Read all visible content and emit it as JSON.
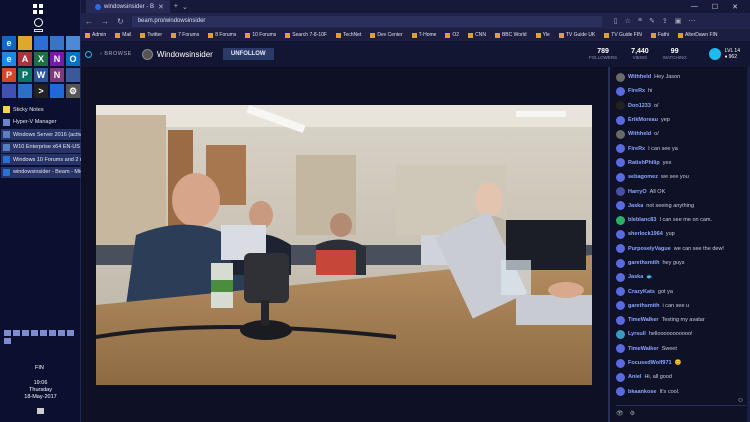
{
  "taskbar": {
    "tiles": [
      {
        "icon": "edge-icon",
        "color": "#1565c0",
        "glyph": "e"
      },
      {
        "icon": "explorer-icon",
        "color": "#e0a62e",
        "glyph": ""
      },
      {
        "icon": "store-icon",
        "color": "#2b6fd6",
        "glyph": ""
      },
      {
        "icon": "weather-icon",
        "color": "#3a74c8",
        "glyph": ""
      },
      {
        "icon": "photos-icon",
        "color": "#4a8ad8",
        "glyph": ""
      },
      {
        "icon": "ie-icon",
        "color": "#1e88e5",
        "glyph": "e"
      },
      {
        "icon": "access-icon",
        "color": "#a4373a",
        "glyph": "A"
      },
      {
        "icon": "excel-icon",
        "color": "#1d7044",
        "glyph": "X"
      },
      {
        "icon": "onenote-icon",
        "color": "#7719aa",
        "glyph": "N"
      },
      {
        "icon": "outlook-icon",
        "color": "#0072c6",
        "glyph": "O"
      },
      {
        "icon": "powerpoint-icon",
        "color": "#d24726",
        "glyph": "P"
      },
      {
        "icon": "publisher-icon",
        "color": "#077568",
        "glyph": "P"
      },
      {
        "icon": "word-icon",
        "color": "#2b579a",
        "glyph": "W"
      },
      {
        "icon": "onenote2-icon",
        "color": "#80397b",
        "glyph": "N"
      },
      {
        "icon": "groove-icon",
        "color": "#3b5998",
        "glyph": ""
      },
      {
        "icon": "people-icon",
        "color": "#3f51b5",
        "glyph": ""
      },
      {
        "icon": "calendar-icon",
        "color": "#2a6fc9",
        "glyph": ""
      },
      {
        "icon": "cmd-icon",
        "color": "#222222",
        "glyph": ">"
      },
      {
        "icon": "mail-icon",
        "color": "#1e6bd6",
        "glyph": ""
      },
      {
        "icon": "settings-icon",
        "color": "#555555",
        "glyph": "⚙"
      }
    ],
    "items": [
      {
        "label": "Sticky Notes",
        "color": "#f0d64a",
        "active": false
      },
      {
        "label": "Hyper-V Manager",
        "color": "#6a88c8",
        "active": false
      },
      {
        "label": "Windows Server 2016 (activate...",
        "color": "#5a7ec0",
        "active": true
      },
      {
        "label": "W10 Enterprise x64 EN-US (VL) ...",
        "color": "#5a7ec0",
        "active": true
      },
      {
        "label": "Windows 10 Forums and 2 mo...",
        "color": "#2b6fd6",
        "active": true
      },
      {
        "label": "windowsinsider - Beam - Micr...",
        "color": "#2b6fd6",
        "active": true
      }
    ],
    "lang": "FIN",
    "time": "19:06",
    "day": "Thursday",
    "date": "18-May-2017"
  },
  "browser": {
    "tab_title": "windowsinsider - B",
    "close_tab": "✕",
    "new_tab": "+",
    "tab_chevron": "⌄",
    "url": "beam.pro/windowsinsider",
    "win_min": "—",
    "win_max": "☐",
    "win_close": "✕",
    "favorites": [
      "Admin",
      "Mail",
      "Twitter",
      "7 Forums",
      "8 Forums",
      "10 Forums",
      "Search 7-8-10F",
      "TechNet",
      "Dev Center",
      "T-Home",
      "O2",
      "CNN",
      "BBC World",
      "Yle",
      "TV Guide UK",
      "TV Guide FIN",
      "Fathi",
      "AlterDawn FIN"
    ]
  },
  "beam": {
    "browse": "BROWSE",
    "channel": "Windowsinsider",
    "unfollow": "UNFOLLOW",
    "stats": [
      {
        "value": "789",
        "label": "FOLLOWERS"
      },
      {
        "value": "7,440",
        "label": "VIEWS"
      },
      {
        "value": "99",
        "label": "WATCHING"
      }
    ],
    "user_level": "LVL 14",
    "user_sparks": "♦ 962"
  },
  "chat": {
    "messages": [
      {
        "user": "Withheld",
        "text": "Hey Jason",
        "color": "#6a6a6a"
      },
      {
        "user": "FireRx",
        "text": "hi",
        "color": "#5a6ae0"
      },
      {
        "user": "Don1233",
        "text": "o/",
        "color": "#222"
      },
      {
        "user": "ErikMoreau",
        "text": "yep",
        "color": "#5a6ae0"
      },
      {
        "user": "Withheld",
        "text": "o/",
        "color": "#6a6a6a"
      },
      {
        "user": "FireRx",
        "text": "I can see ya",
        "color": "#5a6ae0"
      },
      {
        "user": "RatishPhilip",
        "text": "yes",
        "color": "#5a6ae0"
      },
      {
        "user": "sebagomez",
        "text": "we see you",
        "color": "#5a6ae0"
      },
      {
        "user": "HarryO",
        "text": "All OK",
        "color": "#4a50a0"
      },
      {
        "user": "Jaska",
        "text": "not seeing anything",
        "color": "#5a6ae0"
      },
      {
        "user": "bleblanc83",
        "text": "I can see me on cam.",
        "color": "#2ab068"
      },
      {
        "user": "sherlock1964",
        "text": "yup",
        "color": "#5a6ae0"
      },
      {
        "user": "PurposelyVague",
        "text": "we can see the dew!",
        "color": "#5a6ae0"
      },
      {
        "user": "garethsmith",
        "text": "hey guys",
        "color": "#5a6ae0"
      },
      {
        "user": "Jaska",
        "text": "🐟",
        "color": "#5a6ae0"
      },
      {
        "user": "CrazyKats",
        "text": "got ya",
        "color": "#5a6ae0"
      },
      {
        "user": "garethsmith",
        "text": "i can see u",
        "color": "#5a6ae0"
      },
      {
        "user": "TimeWalker",
        "text": "Testing my avatar",
        "color": "#5a6ae0"
      },
      {
        "user": "Lyrsull",
        "text": "hellooooooooooo!",
        "color": "#3a9ac0"
      },
      {
        "user": "TimeWalker",
        "text": "Sweet",
        "color": "#5a6ae0"
      },
      {
        "user": "FocusedWolf971",
        "text": "😊",
        "color": "#5a6ae0"
      },
      {
        "user": "Aniel",
        "text": "Hi, all good",
        "color": "#5a6ae0"
      },
      {
        "user": "bkaankose",
        "text": "It's cool.",
        "color": "#5a6ae0"
      }
    ],
    "smile": "☺",
    "footer_eye": "👁",
    "footer_gear": "⚙"
  }
}
